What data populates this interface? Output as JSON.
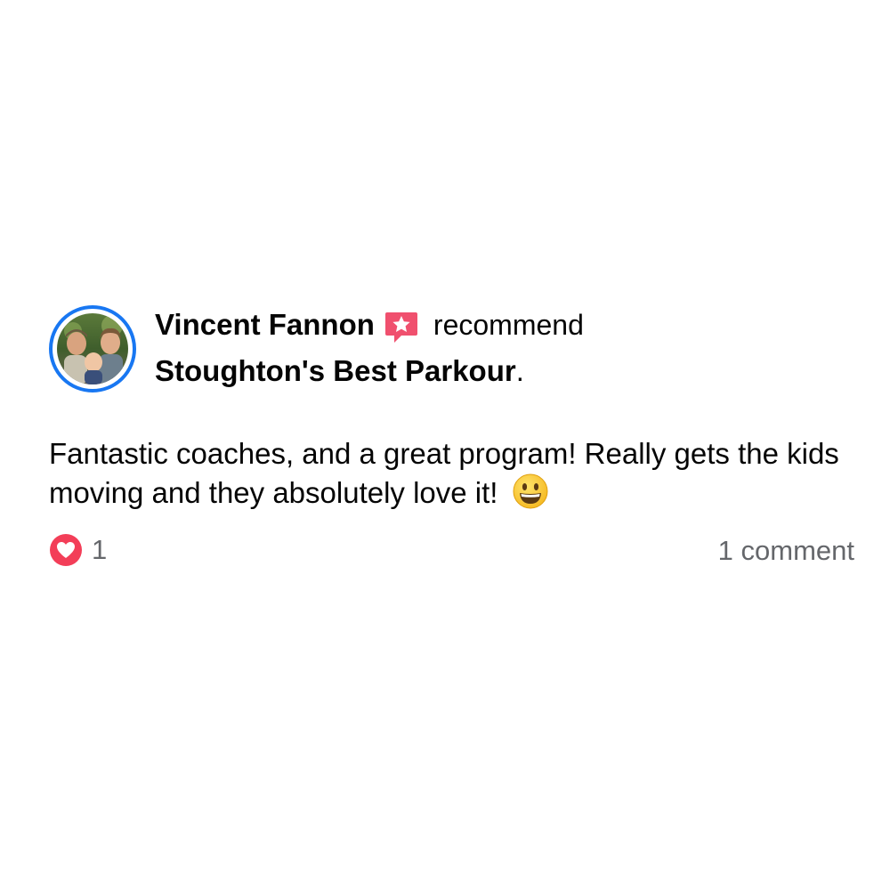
{
  "post": {
    "author": "Vincent Fannon",
    "badge_icon": "recommendation-star-icon",
    "action_text": "recommend",
    "page_name": "Stoughton's Best Parkour",
    "page_suffix": ".",
    "body": "Fantastic coaches, and a great program! Really gets the kids moving and they absolutely love it!",
    "emoji_icon": "grinning-face-emoji",
    "reactions": {
      "icon": "love-reaction-icon",
      "count": "1"
    },
    "comments_label": "1 comment"
  },
  "colors": {
    "avatar_ring": "#1877f2",
    "badge": "#f0506e",
    "love_reaction": "#f33e58",
    "secondary_text": "#65676b",
    "primary_text": "#050505"
  }
}
